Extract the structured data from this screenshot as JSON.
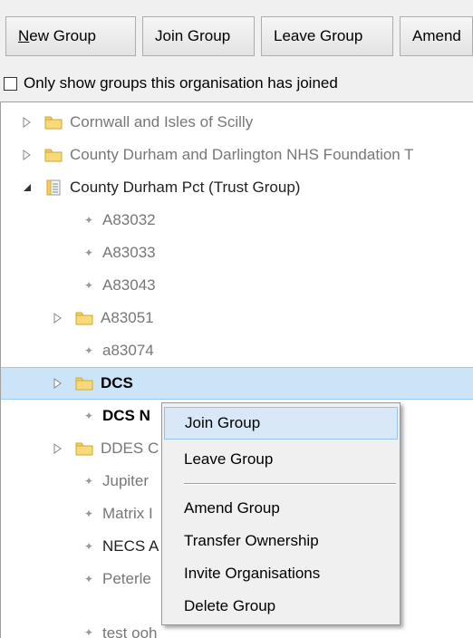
{
  "toolbar": {
    "new_group_accel": "N",
    "new_group_rest": "ew Group",
    "join_group": "Join Group",
    "leave_group": "Leave Group",
    "amend": "Amend"
  },
  "filter": {
    "only_joined_label": "Only show groups this organisation has joined"
  },
  "tree": {
    "items": [
      {
        "label": "Cornwall and Isles of Scilly"
      },
      {
        "label": "County Durham and Darlington NHS Foundation T"
      },
      {
        "label": "County Durham Pct (Trust Group)"
      },
      {
        "label": "A83032"
      },
      {
        "label": "A83033"
      },
      {
        "label": "A83043"
      },
      {
        "label": "A83051"
      },
      {
        "label": "a83074"
      },
      {
        "label": "DCS"
      },
      {
        "label": "DCS N"
      },
      {
        "label": "DDES C"
      },
      {
        "label": "Jupiter"
      },
      {
        "label": "Matrix I"
      },
      {
        "label": "NECS A"
      },
      {
        "label": "Peterle"
      },
      {
        "label": "test ooh"
      }
    ]
  },
  "context_menu": {
    "join_group": "Join Group",
    "leave_group": "Leave Group",
    "amend_group": "Amend Group",
    "transfer_ownership": "Transfer Ownership",
    "invite_organisations": "Invite Organisations",
    "delete_group": "Delete Group"
  },
  "icons": {
    "expand": "triangle-right-icon",
    "collapse": "triangle-down-icon",
    "folder": "folder-icon",
    "document": "document-icon",
    "leaf": "leaf-dot-icon"
  }
}
